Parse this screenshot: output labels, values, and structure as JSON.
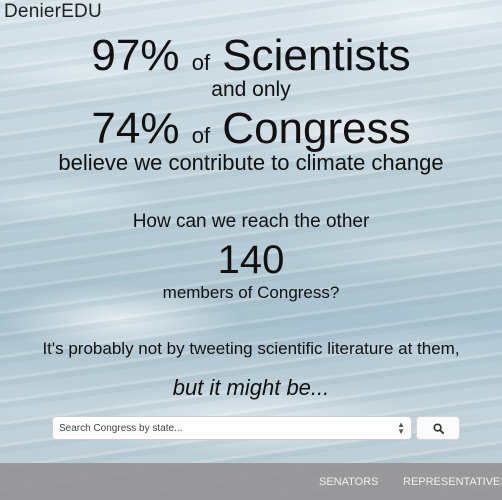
{
  "brand": "DenierEDU",
  "headline": {
    "line1_pct": "97%",
    "line1_of": "of",
    "line1_group": "Scientists",
    "and_only": "and only",
    "line2_pct": "74%",
    "line2_of": "of",
    "line2_group": "Congress",
    "believe": "believe we contribute to climate change"
  },
  "reach": {
    "question": "How can we reach the other",
    "count": "140",
    "members": "members of Congress?"
  },
  "tweet": {
    "text": "It's probably not by tweeting scientific literature at them,",
    "tagline": "but it might be..."
  },
  "search": {
    "placeholder": "Search Congress by state...",
    "button_icon": "search-icon"
  },
  "nav": {
    "senators": "SENATORS",
    "representatives": "REPRESENTATIVES"
  }
}
